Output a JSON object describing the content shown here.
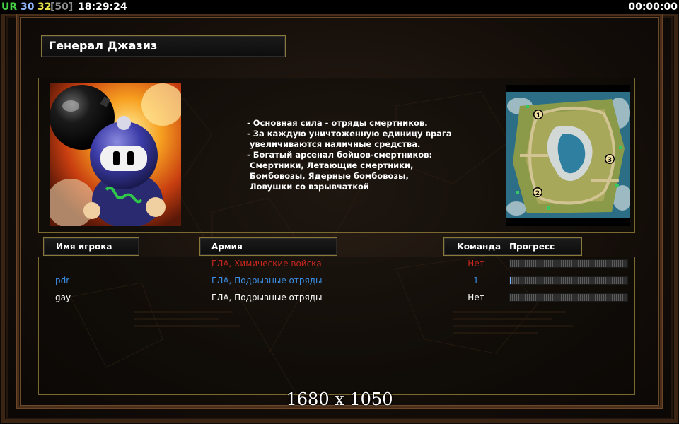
{
  "statusbar": {
    "unit_label": "UR",
    "fps": "30",
    "current": "32",
    "max_bracket": "[50]",
    "clock": "18:29:24",
    "timer": "00:00:00"
  },
  "general": {
    "title": "Генерал Джазиз"
  },
  "description": [
    "- Основная сила - отряды смертников.",
    "- За каждую уничтоженную единицу врага",
    "  увеличиваются наличные средства.",
    "- Богатый арсенал бойцов-смертников:",
    "  Смертники, Летающие смертники,",
    "  Бомбовозы, Ядерные бомбовозы,",
    "  Ловушки со взрывчаткой"
  ],
  "minimap": {
    "start_positions": [
      "1",
      "2",
      "3"
    ]
  },
  "columns": {
    "player": "Имя игрока",
    "army": "Армия",
    "team": "Команда",
    "progress": "Прогресс"
  },
  "players": [
    {
      "name": "",
      "army": "ГЛА, Химические войска",
      "team": "Нет",
      "progress": 0,
      "color": "#c8261e"
    },
    {
      "name": "pdr",
      "army": "ГЛА, Подрывные отряды",
      "team": "1",
      "progress": 0.01,
      "color": "#3a8fe8"
    },
    {
      "name": "gay",
      "army": "ГЛА, Подрывные отряды",
      "team": "Нет",
      "progress": 0,
      "color": "#ffffff"
    }
  ],
  "resolution_caption": "1680 x 1050"
}
